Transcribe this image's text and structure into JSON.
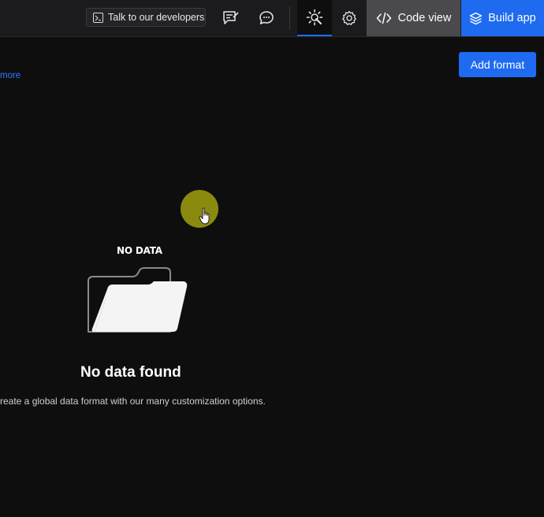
{
  "topbar": {
    "talk_label": "Talk to our developers",
    "code_view_label": "Code view",
    "build_app_label": "Build app"
  },
  "main": {
    "more_link": "more",
    "add_format_label": "Add format",
    "empty_state": {
      "illustration_label": "NO DATA",
      "title": "No data found",
      "description": "reate a global data format with our many customization options."
    }
  },
  "colors": {
    "background": "#0e0e0f",
    "topbar": "#1b1b1d",
    "accent": "#1e6bf0",
    "code_view_bg": "#4a4a4d",
    "cursor_highlight": "#8a8a0f"
  }
}
